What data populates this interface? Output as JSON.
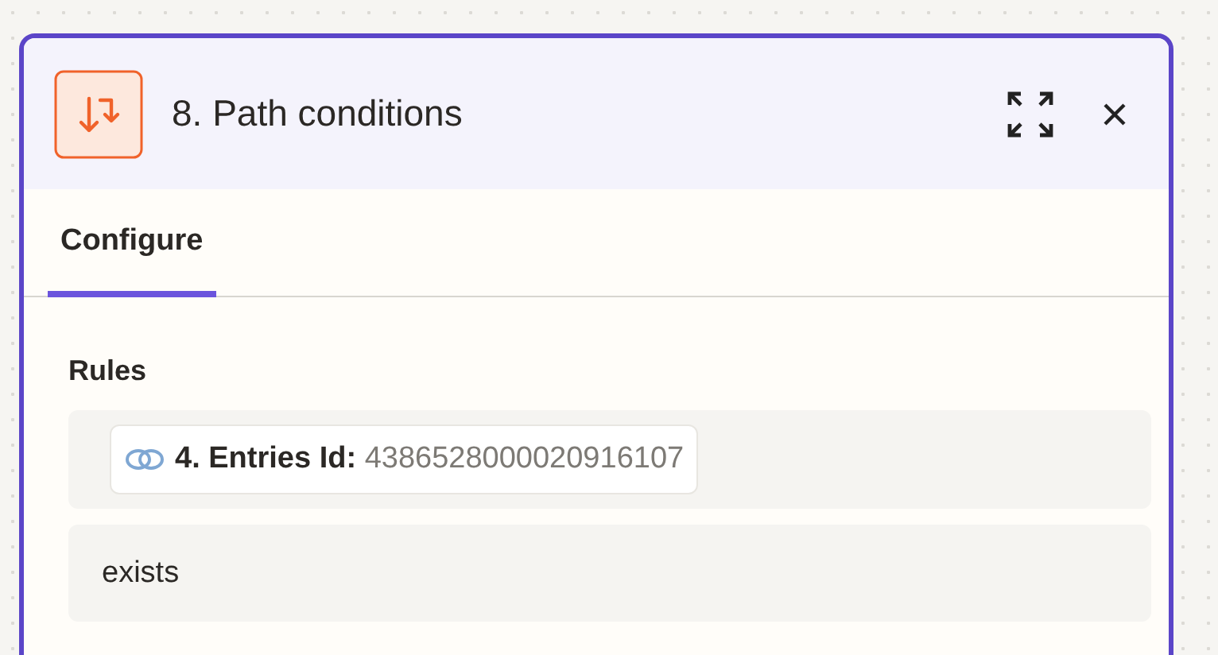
{
  "panel": {
    "title": "8. Path conditions"
  },
  "tabs": [
    {
      "label": "Configure",
      "selected": true
    }
  ],
  "rules": {
    "label": "Rules",
    "field": {
      "label": "4. Entries Id:",
      "value": "4386528000020916107"
    },
    "condition": "exists"
  }
}
